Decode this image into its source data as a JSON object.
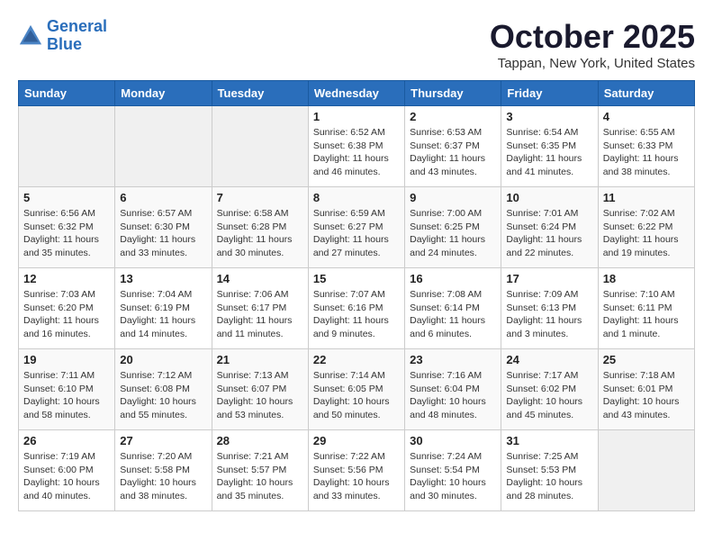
{
  "header": {
    "logo_line1": "General",
    "logo_line2": "Blue",
    "month": "October 2025",
    "location": "Tappan, New York, United States"
  },
  "weekdays": [
    "Sunday",
    "Monday",
    "Tuesday",
    "Wednesday",
    "Thursday",
    "Friday",
    "Saturday"
  ],
  "weeks": [
    [
      {
        "day": "",
        "info": ""
      },
      {
        "day": "",
        "info": ""
      },
      {
        "day": "",
        "info": ""
      },
      {
        "day": "1",
        "info": "Sunrise: 6:52 AM\nSunset: 6:38 PM\nDaylight: 11 hours\nand 46 minutes."
      },
      {
        "day": "2",
        "info": "Sunrise: 6:53 AM\nSunset: 6:37 PM\nDaylight: 11 hours\nand 43 minutes."
      },
      {
        "day": "3",
        "info": "Sunrise: 6:54 AM\nSunset: 6:35 PM\nDaylight: 11 hours\nand 41 minutes."
      },
      {
        "day": "4",
        "info": "Sunrise: 6:55 AM\nSunset: 6:33 PM\nDaylight: 11 hours\nand 38 minutes."
      }
    ],
    [
      {
        "day": "5",
        "info": "Sunrise: 6:56 AM\nSunset: 6:32 PM\nDaylight: 11 hours\nand 35 minutes."
      },
      {
        "day": "6",
        "info": "Sunrise: 6:57 AM\nSunset: 6:30 PM\nDaylight: 11 hours\nand 33 minutes."
      },
      {
        "day": "7",
        "info": "Sunrise: 6:58 AM\nSunset: 6:28 PM\nDaylight: 11 hours\nand 30 minutes."
      },
      {
        "day": "8",
        "info": "Sunrise: 6:59 AM\nSunset: 6:27 PM\nDaylight: 11 hours\nand 27 minutes."
      },
      {
        "day": "9",
        "info": "Sunrise: 7:00 AM\nSunset: 6:25 PM\nDaylight: 11 hours\nand 24 minutes."
      },
      {
        "day": "10",
        "info": "Sunrise: 7:01 AM\nSunset: 6:24 PM\nDaylight: 11 hours\nand 22 minutes."
      },
      {
        "day": "11",
        "info": "Sunrise: 7:02 AM\nSunset: 6:22 PM\nDaylight: 11 hours\nand 19 minutes."
      }
    ],
    [
      {
        "day": "12",
        "info": "Sunrise: 7:03 AM\nSunset: 6:20 PM\nDaylight: 11 hours\nand 16 minutes."
      },
      {
        "day": "13",
        "info": "Sunrise: 7:04 AM\nSunset: 6:19 PM\nDaylight: 11 hours\nand 14 minutes."
      },
      {
        "day": "14",
        "info": "Sunrise: 7:06 AM\nSunset: 6:17 PM\nDaylight: 11 hours\nand 11 minutes."
      },
      {
        "day": "15",
        "info": "Sunrise: 7:07 AM\nSunset: 6:16 PM\nDaylight: 11 hours\nand 9 minutes."
      },
      {
        "day": "16",
        "info": "Sunrise: 7:08 AM\nSunset: 6:14 PM\nDaylight: 11 hours\nand 6 minutes."
      },
      {
        "day": "17",
        "info": "Sunrise: 7:09 AM\nSunset: 6:13 PM\nDaylight: 11 hours\nand 3 minutes."
      },
      {
        "day": "18",
        "info": "Sunrise: 7:10 AM\nSunset: 6:11 PM\nDaylight: 11 hours\nand 1 minute."
      }
    ],
    [
      {
        "day": "19",
        "info": "Sunrise: 7:11 AM\nSunset: 6:10 PM\nDaylight: 10 hours\nand 58 minutes."
      },
      {
        "day": "20",
        "info": "Sunrise: 7:12 AM\nSunset: 6:08 PM\nDaylight: 10 hours\nand 55 minutes."
      },
      {
        "day": "21",
        "info": "Sunrise: 7:13 AM\nSunset: 6:07 PM\nDaylight: 10 hours\nand 53 minutes."
      },
      {
        "day": "22",
        "info": "Sunrise: 7:14 AM\nSunset: 6:05 PM\nDaylight: 10 hours\nand 50 minutes."
      },
      {
        "day": "23",
        "info": "Sunrise: 7:16 AM\nSunset: 6:04 PM\nDaylight: 10 hours\nand 48 minutes."
      },
      {
        "day": "24",
        "info": "Sunrise: 7:17 AM\nSunset: 6:02 PM\nDaylight: 10 hours\nand 45 minutes."
      },
      {
        "day": "25",
        "info": "Sunrise: 7:18 AM\nSunset: 6:01 PM\nDaylight: 10 hours\nand 43 minutes."
      }
    ],
    [
      {
        "day": "26",
        "info": "Sunrise: 7:19 AM\nSunset: 6:00 PM\nDaylight: 10 hours\nand 40 minutes."
      },
      {
        "day": "27",
        "info": "Sunrise: 7:20 AM\nSunset: 5:58 PM\nDaylight: 10 hours\nand 38 minutes."
      },
      {
        "day": "28",
        "info": "Sunrise: 7:21 AM\nSunset: 5:57 PM\nDaylight: 10 hours\nand 35 minutes."
      },
      {
        "day": "29",
        "info": "Sunrise: 7:22 AM\nSunset: 5:56 PM\nDaylight: 10 hours\nand 33 minutes."
      },
      {
        "day": "30",
        "info": "Sunrise: 7:24 AM\nSunset: 5:54 PM\nDaylight: 10 hours\nand 30 minutes."
      },
      {
        "day": "31",
        "info": "Sunrise: 7:25 AM\nSunset: 5:53 PM\nDaylight: 10 hours\nand 28 minutes."
      },
      {
        "day": "",
        "info": ""
      }
    ]
  ]
}
